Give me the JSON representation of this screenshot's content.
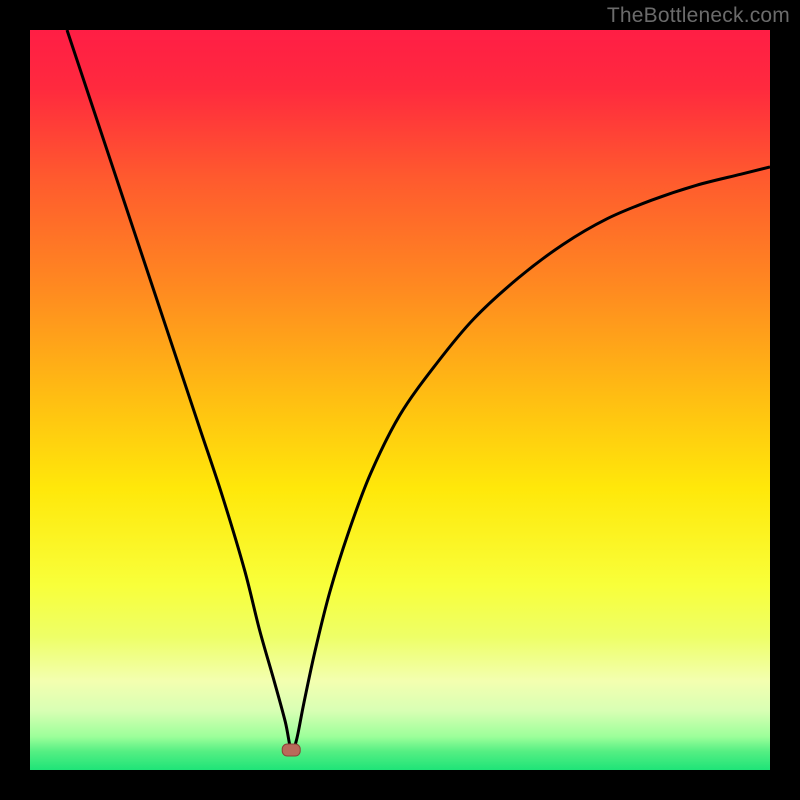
{
  "watermark": "TheBottleneck.com",
  "colors": {
    "black": "#000000",
    "curve": "#000000",
    "marker_fill": "#b96a5a",
    "marker_stroke": "#8a4437",
    "gradient_stops": [
      {
        "offset": 0,
        "color": "#ff1e45"
      },
      {
        "offset": 0.08,
        "color": "#ff2a3e"
      },
      {
        "offset": 0.2,
        "color": "#ff5a2e"
      },
      {
        "offset": 0.35,
        "color": "#ff8a20"
      },
      {
        "offset": 0.5,
        "color": "#ffbf12"
      },
      {
        "offset": 0.62,
        "color": "#ffe80a"
      },
      {
        "offset": 0.75,
        "color": "#f8ff3a"
      },
      {
        "offset": 0.82,
        "color": "#eeff67"
      },
      {
        "offset": 0.88,
        "color": "#f3ffb0"
      },
      {
        "offset": 0.92,
        "color": "#d8ffb4"
      },
      {
        "offset": 0.955,
        "color": "#9cff9a"
      },
      {
        "offset": 0.975,
        "color": "#55ef83"
      },
      {
        "offset": 1.0,
        "color": "#1ee478"
      }
    ]
  },
  "chart_data": {
    "type": "line",
    "title": "",
    "xlabel": "",
    "ylabel": "",
    "xlim": [
      0,
      100
    ],
    "ylim": [
      0,
      100
    ],
    "legend": false,
    "grid": false,
    "series": [
      {
        "name": "bottleneck-curve",
        "x": [
          5,
          8,
          11,
          14,
          17,
          20,
          23,
          26,
          29,
          31,
          33,
          34.5,
          35.3,
          36,
          37,
          38.5,
          40.5,
          43,
          46,
          50,
          55,
          60,
          66,
          72,
          78,
          84,
          90,
          96,
          100
        ],
        "y": [
          100,
          91,
          82,
          73,
          64,
          55,
          46,
          37,
          27,
          19,
          12,
          6.5,
          2.7,
          4,
          9,
          16,
          24,
          32,
          40,
          48,
          55,
          61,
          66.5,
          71,
          74.5,
          77,
          79,
          80.5,
          81.5
        ]
      }
    ],
    "annotations": [
      {
        "name": "marker",
        "x": 35.3,
        "y": 2.7,
        "shape": "rounded-rect"
      }
    ]
  }
}
